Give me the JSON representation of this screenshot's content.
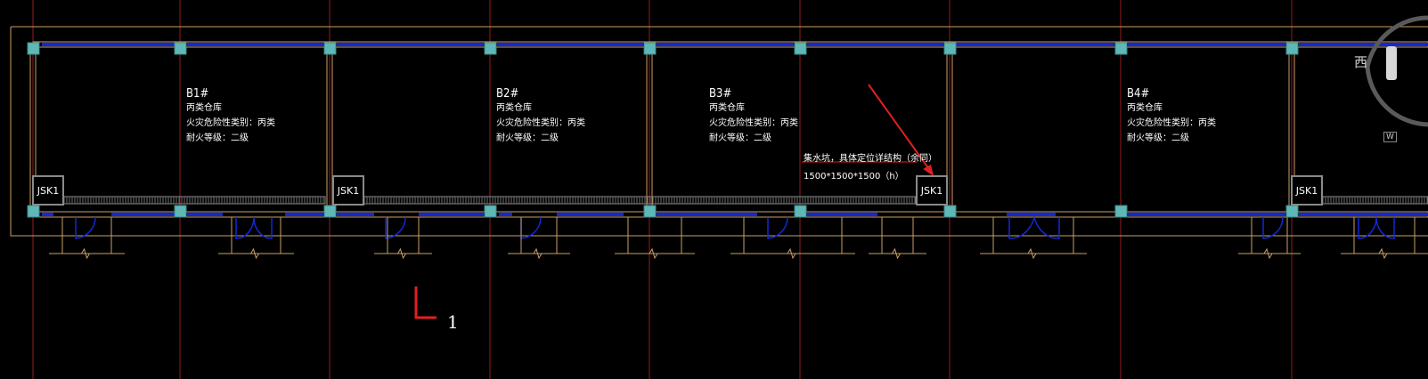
{
  "rooms": [
    {
      "code": "B1#",
      "type": "丙类仓库",
      "fire_class": "火灾危险性类别：丙类",
      "rating": "耐火等级：二级"
    },
    {
      "code": "B2#",
      "type": "丙类仓库",
      "fire_class": "火灾危险性类别：丙类",
      "rating": "耐火等级：二级"
    },
    {
      "code": "B3#",
      "type": "丙类仓库",
      "fire_class": "火灾危险性类别：丙类",
      "rating": "耐火等级：二级"
    },
    {
      "code": "B4#",
      "type": "丙类仓库",
      "fire_class": "火灾危险性类别：丙类",
      "rating": "耐火等级：二级"
    }
  ],
  "pits": [
    "JSK1",
    "JSK1",
    "JSK1",
    "JSK1"
  ],
  "annotation": {
    "line1": "集水坑，具体定位详结构（余同）",
    "line2": "1500*1500*1500（h）"
  },
  "section_marker": {
    "number": "1"
  },
  "viewcube": {
    "label": "西",
    "w_label": "W"
  },
  "colors": {
    "background": "#000000",
    "wall": "#c9a063",
    "window": "#1428d8",
    "column": "#5fb8b8",
    "grid_line": "#b02020",
    "annotation_arrow": "#e02020"
  }
}
